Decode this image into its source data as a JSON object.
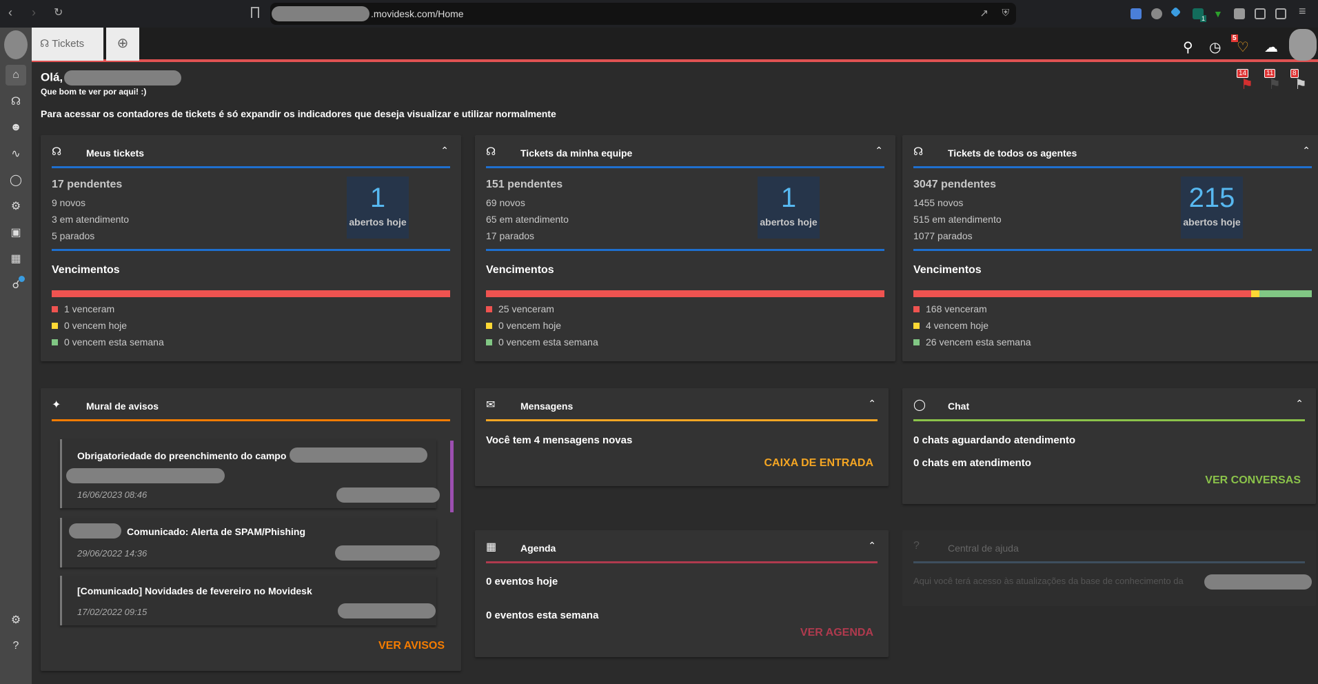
{
  "browser": {
    "url_suffix": ".movidesk.com/Home",
    "extension_badge": "1"
  },
  "app": {
    "tab_label": "Tickets",
    "notification_count": "5"
  },
  "greeting": {
    "hello": "Olá,",
    "subtitle": "Que bom te ver por aqui! :)",
    "hint": "Para acessar os contadores de tickets é só expandir os indicadores que deseja visualizar e utilizar normalmente"
  },
  "flags": [
    {
      "count": "14",
      "color": "#d32f2f"
    },
    {
      "count": "11",
      "color": "#4a4a4a"
    },
    {
      "count": "8",
      "color": "#cccccc"
    }
  ],
  "sidebar": {
    "items": [
      "home-icon",
      "headset-icon",
      "users-icon",
      "chart-line-icon",
      "chat-icon",
      "robot-icon",
      "inbox-icon",
      "calendar-icon",
      "trophy-icon"
    ],
    "bottom": [
      "gear-icon",
      "help-icon"
    ]
  },
  "ticket_cards": [
    {
      "title": "Meus tickets",
      "pending": "17 pendentes",
      "novos": "9 novos",
      "atendimento": "3 em atendimento",
      "parados": "5 parados",
      "today_count": "1",
      "today_label": "abertos hoje",
      "venc_title": "Vencimentos",
      "venceram": "1 venceram",
      "hoje": "0 vencem hoje",
      "semana": "0 vencem esta semana",
      "values": [
        1,
        0,
        0
      ]
    },
    {
      "title": "Tickets da minha equipe",
      "pending": "151 pendentes",
      "novos": "69 novos",
      "atendimento": "65 em atendimento",
      "parados": "17 parados",
      "today_count": "1",
      "today_label": "abertos hoje",
      "venc_title": "Vencimentos",
      "venceram": "25 venceram",
      "hoje": "0 vencem hoje",
      "semana": "0 vencem esta semana",
      "values": [
        25,
        0,
        0
      ]
    },
    {
      "title": "Tickets de todos os agentes",
      "pending": "3047 pendentes",
      "novos": "1455 novos",
      "atendimento": "515 em atendimento",
      "parados": "1077 parados",
      "today_count": "215",
      "today_label": "abertos hoje",
      "venc_title": "Vencimentos",
      "venceram": "168 venceram",
      "hoje": "4 vencem hoje",
      "semana": "26 vencem esta semana",
      "values": [
        168,
        4,
        26
      ]
    }
  ],
  "colors": {
    "red": "#ef5350",
    "yellow": "#fdd835",
    "green": "#81c784",
    "blue": "#1e6fcf",
    "orange": "#f57c00",
    "amber": "#f5a623",
    "chat_green": "#8bc34a",
    "agenda": "#b03a4e"
  },
  "mural": {
    "title": "Mural de avisos",
    "items": [
      {
        "title": "Obrigatoriedade do preenchimento do campo",
        "date": "16/06/2023 08:46"
      },
      {
        "title": "Comunicado: Alerta de SPAM/Phishing",
        "date": "29/06/2022 14:36"
      },
      {
        "title": "[Comunicado] Novidades de fevereiro no Movidesk",
        "date": "17/02/2022 09:15"
      }
    ],
    "link": "VER AVISOS"
  },
  "mensagens": {
    "title": "Mensagens",
    "text": "Você tem 4 mensagens novas",
    "link": "CAIXA DE ENTRADA"
  },
  "agenda": {
    "title": "Agenda",
    "hoje": "0 eventos hoje",
    "semana": "0 eventos esta semana",
    "link": "VER AGENDA"
  },
  "chat": {
    "title": "Chat",
    "aguardando": "0 chats aguardando atendimento",
    "em_atendimento": "0 chats em atendimento",
    "link": "VER CONVERSAS"
  },
  "ajuda": {
    "title": "Central de ajuda",
    "text": "Aqui você terá acesso às atualizações da base de conhecimento da"
  }
}
